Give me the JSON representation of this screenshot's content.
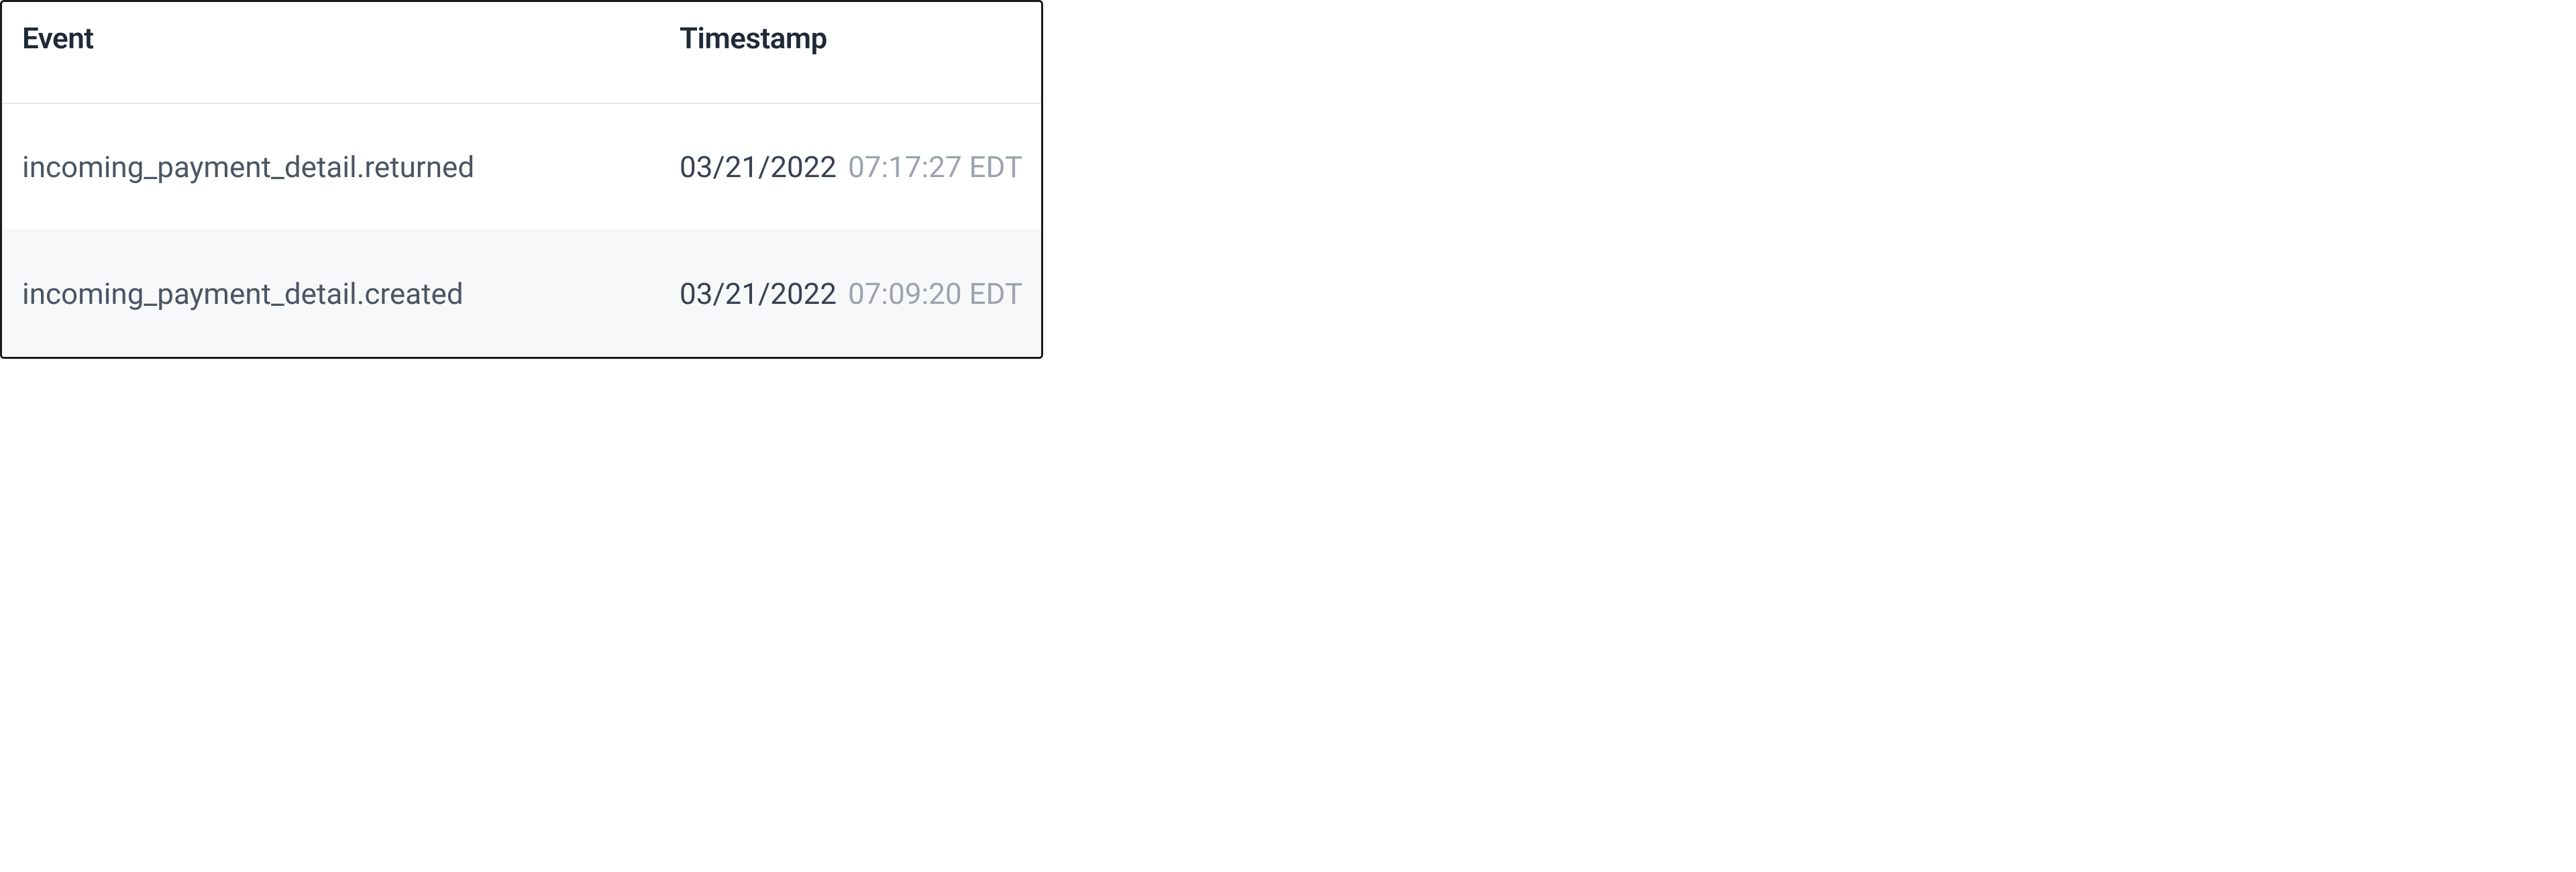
{
  "table": {
    "headers": {
      "event": "Event",
      "timestamp": "Timestamp"
    },
    "rows": [
      {
        "event": "incoming_payment_detail.returned",
        "date": "03/21/2022",
        "time": "07:17:27 EDT"
      },
      {
        "event": "incoming_payment_detail.created",
        "date": "03/21/2022",
        "time": "07:09:20 EDT"
      }
    ]
  }
}
